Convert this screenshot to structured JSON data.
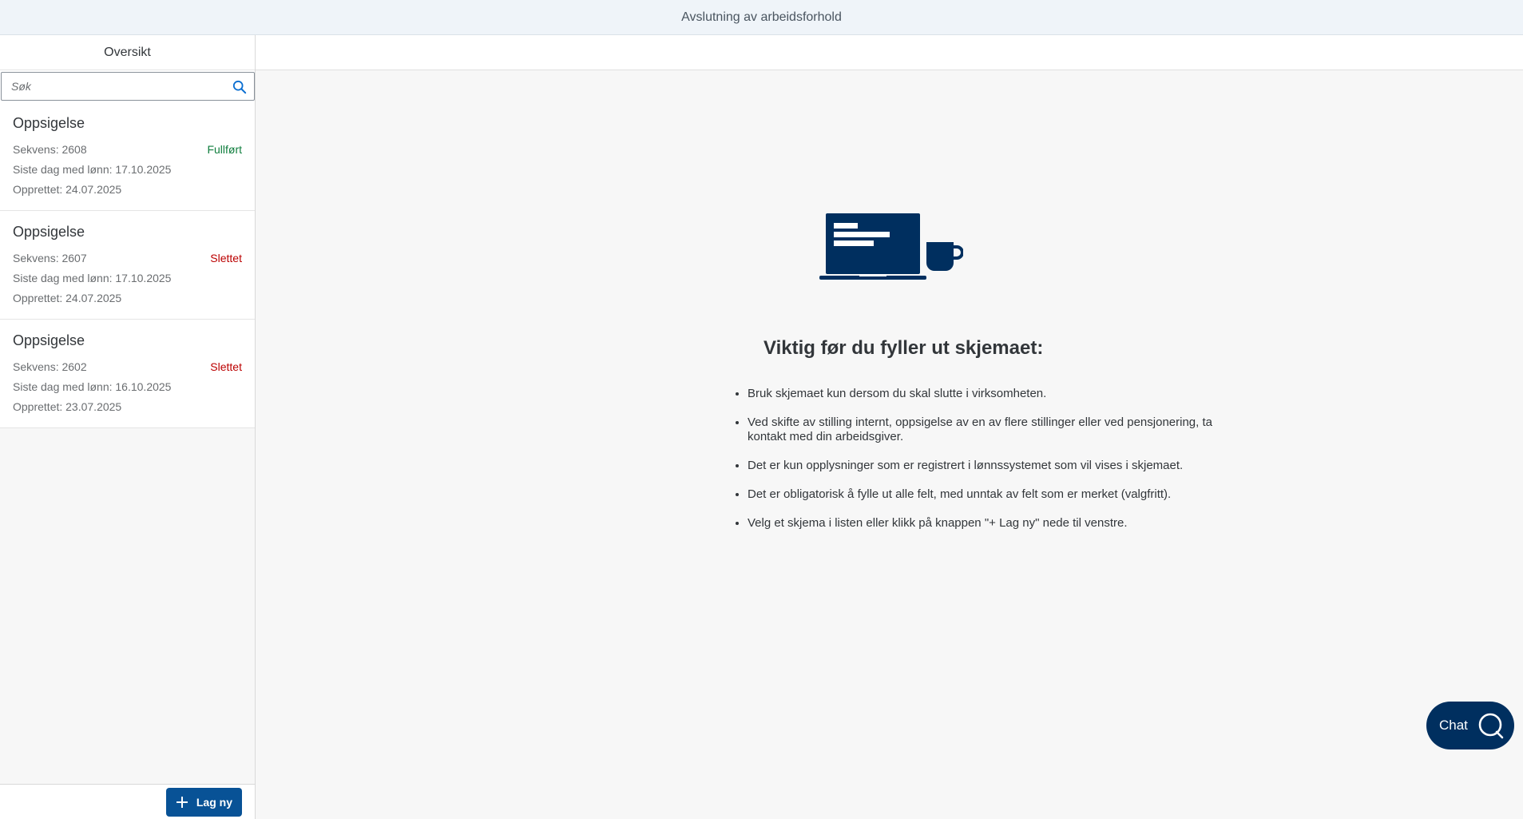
{
  "app": {
    "title": "Avslutning av arbeidsforhold"
  },
  "master": {
    "title": "Oversikt",
    "search": {
      "placeholder": "Søk",
      "value": ""
    },
    "items": [
      {
        "title": "Oppsigelse",
        "sequence": "Sekvens: 2608",
        "status": "Fullført",
        "status_color": "#107e3e",
        "last_day": "Siste dag med lønn: 17.10.2025",
        "created": "Opprettet: 24.07.2025"
      },
      {
        "title": "Oppsigelse",
        "sequence": "Sekvens: 2607",
        "status": "Slettet",
        "status_color": "#bb0000",
        "last_day": "Siste dag med lønn: 17.10.2025",
        "created": "Opprettet: 24.07.2025"
      },
      {
        "title": "Oppsigelse",
        "sequence": "Sekvens: 2602",
        "status": "Slettet",
        "status_color": "#bb0000",
        "last_day": "Siste dag med lønn: 16.10.2025",
        "created": "Opprettet: 23.07.2025"
      }
    ],
    "new_button_label": "Lag ny"
  },
  "detail": {
    "illustration": "laptop-coffee-icon",
    "title": "Viktig før du fyller ut skjemaet:",
    "bullets": [
      "Bruk skjemaet kun dersom du skal slutte i virksomheten.",
      "Ved skifte av stilling internt, oppsigelse av en av flere stillinger eller ved pensjonering, ta kontakt med din arbeidsgiver.",
      "Det er kun opplysninger som er registrert i lønnssystemet som vil vises i skjemaet.",
      "Det er obligatorisk å fylle ut alle felt, med unntak av felt som er merket (valgfritt).",
      "Velg et skjema i listen eller klikk på knappen \"+ Lag ny\" nede til venstre."
    ]
  },
  "chat": {
    "label": "Chat"
  },
  "colors": {
    "header_bg": "#eff4f9",
    "brand_dark": "#002f5f",
    "button": "#085296",
    "success": "#107e3e",
    "error": "#bb0000"
  }
}
